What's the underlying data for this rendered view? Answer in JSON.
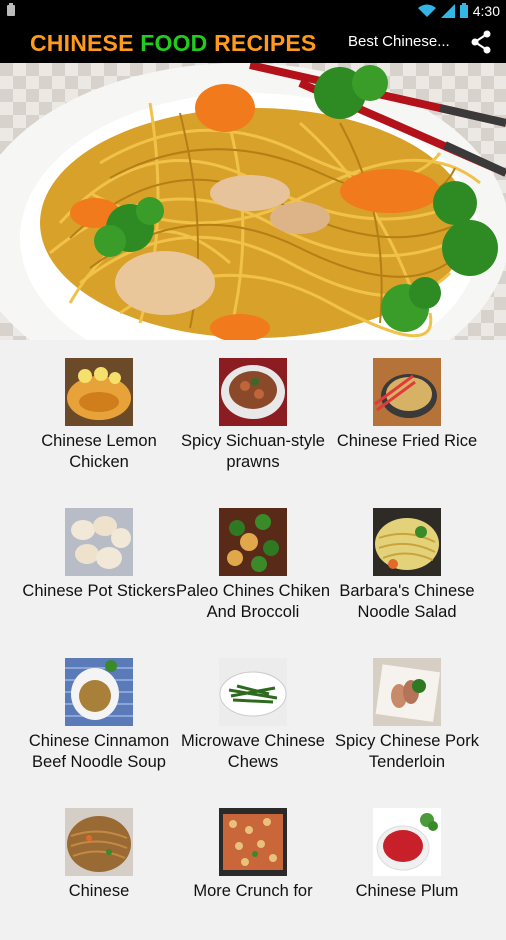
{
  "status_bar": {
    "time": "4:30"
  },
  "header": {
    "title_part1": "CHINESE",
    "title_part2": "FOOD",
    "title_part3": "RECIPES",
    "subtitle": "Best Chinese...",
    "share_icon": "share-icon"
  },
  "colors": {
    "title_orange": "#ff9a1f",
    "title_green": "#22cc1e",
    "bar": "#000000",
    "background": "#f1f1f1"
  },
  "recipes": [
    {
      "label": "Chinese Lemon Chicken"
    },
    {
      "label": "Spicy Sichuan-style prawns"
    },
    {
      "label": "Chinese Fried Rice"
    },
    {
      "label": "Chinese Pot Stickers"
    },
    {
      "label": "Paleo Chines Chiken And Broccoli"
    },
    {
      "label": "Barbara's Chinese Noodle Salad"
    },
    {
      "label": "Chinese Cinnamon Beef Noodle Soup"
    },
    {
      "label": "Microwave Chinese Chews"
    },
    {
      "label": "Spicy Chinese Pork Tenderloin"
    },
    {
      "label": "Chinese"
    },
    {
      "label": "More Crunch for"
    },
    {
      "label": "Chinese Plum"
    }
  ]
}
